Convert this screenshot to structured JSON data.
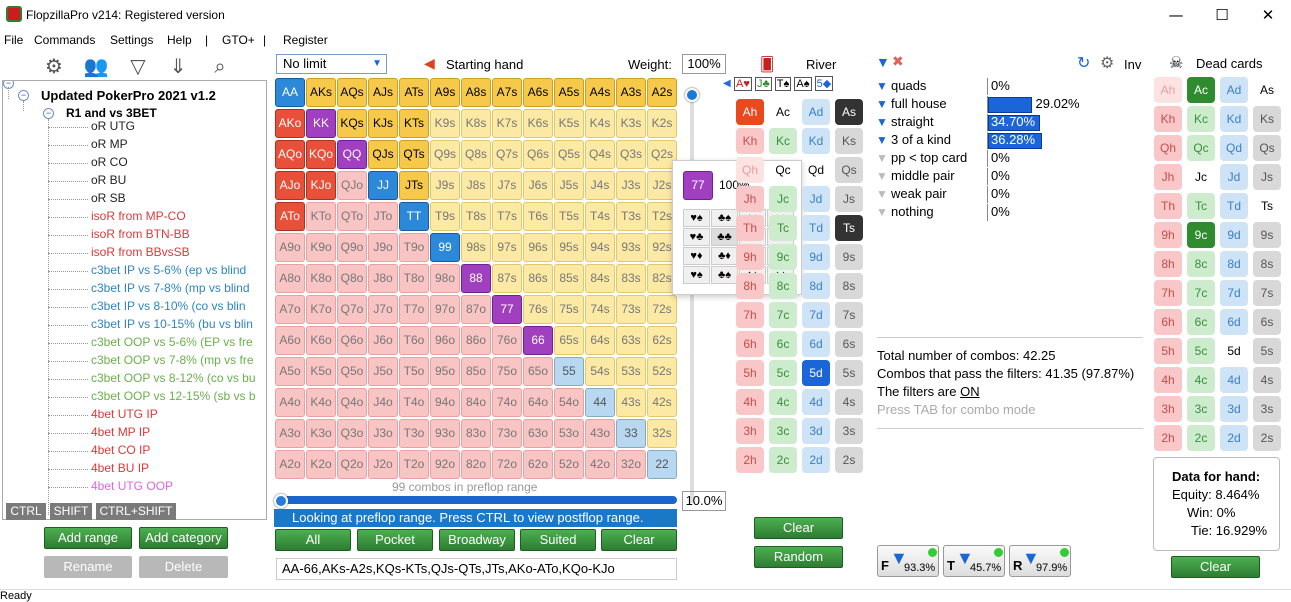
{
  "window": {
    "title": "FlopzillaPro v214: Registered version",
    "minimize": "—",
    "maximize": "☐",
    "close": "✕"
  },
  "menu": [
    "File",
    "Commands",
    "Settings",
    "Help",
    "|",
    "GTO+",
    "|",
    "Register"
  ],
  "tree": {
    "root": "Updated PokerPro 2021 v1.2",
    "group": "R1 and vs 3BET",
    "items": [
      {
        "label": "oR UTG",
        "color": "#222"
      },
      {
        "label": "oR MP",
        "color": "#222"
      },
      {
        "label": "oR CO",
        "color": "#222"
      },
      {
        "label": "oR BU",
        "color": "#222"
      },
      {
        "label": "oR SB",
        "color": "#222"
      },
      {
        "label": "isoR from MP-CO",
        "color": "#d93a3a"
      },
      {
        "label": "isoR from BTN-BB",
        "color": "#d93a3a"
      },
      {
        "label": "isoR from BBvsSB",
        "color": "#d93a3a"
      },
      {
        "label": "c3bet IP vs 5-6% (ep vs blind",
        "color": "#2e86c1"
      },
      {
        "label": "c3bet IP vs 7-8% (mp vs blind",
        "color": "#2e86c1"
      },
      {
        "label": "c3bet IP vs 8-10% (co vs blin",
        "color": "#2e86c1"
      },
      {
        "label": "c3bet IP vs 10-15% (bu vs blin",
        "color": "#2e86c1"
      },
      {
        "label": "c3bet OOP vs 5-6% (EP vs fre",
        "color": "#6ab04c"
      },
      {
        "label": "c3bet OOP vs 7-8% (mp vs fre",
        "color": "#6ab04c"
      },
      {
        "label": "c3bet OOP vs 8-12% (co vs bu",
        "color": "#6ab04c"
      },
      {
        "label": "c3bet OOP vs 12-15% (sb vs b",
        "color": "#6ab04c"
      },
      {
        "label": "4bet UTG IP",
        "color": "#d93a3a"
      },
      {
        "label": "4bet MP IP",
        "color": "#d93a3a"
      },
      {
        "label": "4bet CO IP",
        "color": "#d93a3a"
      },
      {
        "label": "4bet BU IP",
        "color": "#d93a3a"
      },
      {
        "label": "4bet UTG OOP",
        "color": "#e066e0"
      }
    ],
    "keys": [
      "CTRL",
      "SHIFT",
      "CTRL+SHIFT"
    ]
  },
  "tree_buttons": {
    "add_range": "Add range",
    "add_category": "Add category",
    "rename": "Rename",
    "delete": "Delete"
  },
  "range": {
    "limit": "No limit",
    "starting_hand": "Starting hand",
    "weight_label": "Weight:",
    "weight": "100%",
    "combos_text": "99 combos in preflop range",
    "slider_pct": "10.0%",
    "slider_fraction": 0.1,
    "info": "Looking at preflop range. Press CTRL to view postflop range.",
    "text": "AA-66,AKs-A2s,KQs-KTs,QJs-QTs,JTs,AKo-ATo,KQo-KJo",
    "buttons": [
      "All",
      "Pocket",
      "Broadway",
      "Suited",
      "Clear"
    ],
    "ranks": [
      "A",
      "K",
      "Q",
      "J",
      "T",
      "9",
      "8",
      "7",
      "6",
      "5",
      "4",
      "3",
      "2"
    ],
    "selected": [
      "AA",
      "KK",
      "QQ",
      "JJ",
      "TT",
      "99",
      "88",
      "77",
      "66",
      "AKs",
      "AQs",
      "AJs",
      "ATs",
      "A9s",
      "A8s",
      "A7s",
      "A6s",
      "A5s",
      "A4s",
      "A3s",
      "A2s",
      "KQs",
      "KJs",
      "KTs",
      "QJs",
      "QTs",
      "JTs",
      "AKo",
      "AQo",
      "AJo",
      "ATo",
      "KQo",
      "KJo"
    ],
    "light_pairs": [
      "55",
      "44",
      "33",
      "22"
    ],
    "purple": [
      "KK",
      "QQ",
      "88",
      "77",
      "66"
    ]
  },
  "popup": {
    "hand": "77",
    "pct": "100%",
    "combos": [
      [
        "♥♠",
        "♣♠",
        "♦♠",
        "♠♠"
      ],
      [
        "♥♣",
        "♣♣",
        "♦♣",
        "♠♣"
      ],
      [
        "♥♦",
        "♣♦",
        "♦♦",
        "♠♦"
      ],
      [
        "♥♠",
        "♣♠",
        "♦♠",
        "♠♠"
      ]
    ]
  },
  "board": {
    "label": "River",
    "flop": "A♥",
    "turn": "J♣",
    "river": "T♠",
    "s4": "A♠",
    "s5": "5◆"
  },
  "filters": {
    "inv": "Inv",
    "rows": [
      {
        "label": "quads",
        "value": "0%",
        "bar": 0,
        "active": true
      },
      {
        "label": "full house",
        "value": "29.02%",
        "bar": 0.2902,
        "active": true
      },
      {
        "label": "straight",
        "value": "34.70%",
        "bar": 0.347,
        "active": true
      },
      {
        "label": "3 of a kind",
        "value": "36.28%",
        "bar": 0.3628,
        "active": true
      },
      {
        "label": "pp < top card",
        "value": "0%",
        "bar": 0,
        "active": false
      },
      {
        "label": "middle pair",
        "value": "0%",
        "bar": 0,
        "active": false
      },
      {
        "label": "weak pair",
        "value": "0%",
        "bar": 0,
        "active": false
      },
      {
        "label": "nothing",
        "value": "0%",
        "bar": 0,
        "active": false
      }
    ],
    "total": "Total number of combos: 42.25",
    "pass": "Combos that pass the filters: 41.35 (97.87%)",
    "filters_on_prefix": "The filters are ",
    "filters_on": "ON",
    "tab_hint": "Press TAB for combo mode"
  },
  "dead": {
    "label": "Dead cards",
    "hand_title": "Data for hand:",
    "equity": "Equity: 8.464%",
    "win": "Win: 0%",
    "tie": "Tie: 16.929%",
    "clear": "Clear"
  },
  "board_buttons": {
    "clear": "Clear",
    "random": "Random"
  },
  "street_buttons": [
    {
      "letter": "F",
      "pct": "93.3%"
    },
    {
      "letter": "T",
      "pct": "45.7%"
    },
    {
      "letter": "R",
      "pct": "97.9%"
    }
  ],
  "status": "Ready"
}
